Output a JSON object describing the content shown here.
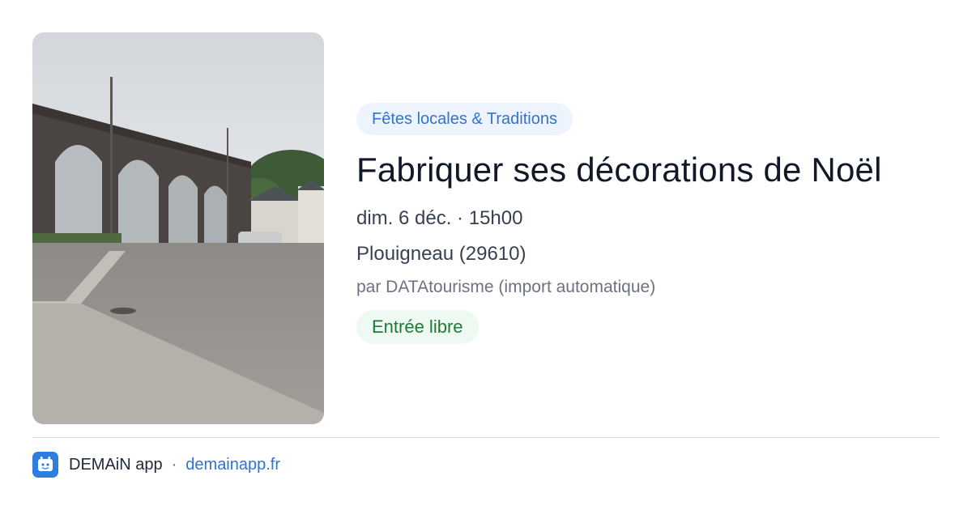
{
  "event": {
    "category": "Fêtes locales & Traditions",
    "title": "Fabriquer ses décorations de Noël",
    "date": "dim. 6 déc. · 15h00",
    "location": "Plouigneau (29610)",
    "organizer": "par DATAtourisme (import automatique)",
    "price": "Entrée libre"
  },
  "footer": {
    "app_name": "DEMAiN app",
    "separator": "·",
    "site": "demainapp.fr"
  },
  "colors": {
    "accent": "#3273cc",
    "category_bg": "#eef4fd",
    "price_text": "#1f7a3a",
    "price_bg": "#eefaf1",
    "title": "#111827"
  },
  "icons": {
    "app_logo": "demain-app-logo-icon"
  }
}
